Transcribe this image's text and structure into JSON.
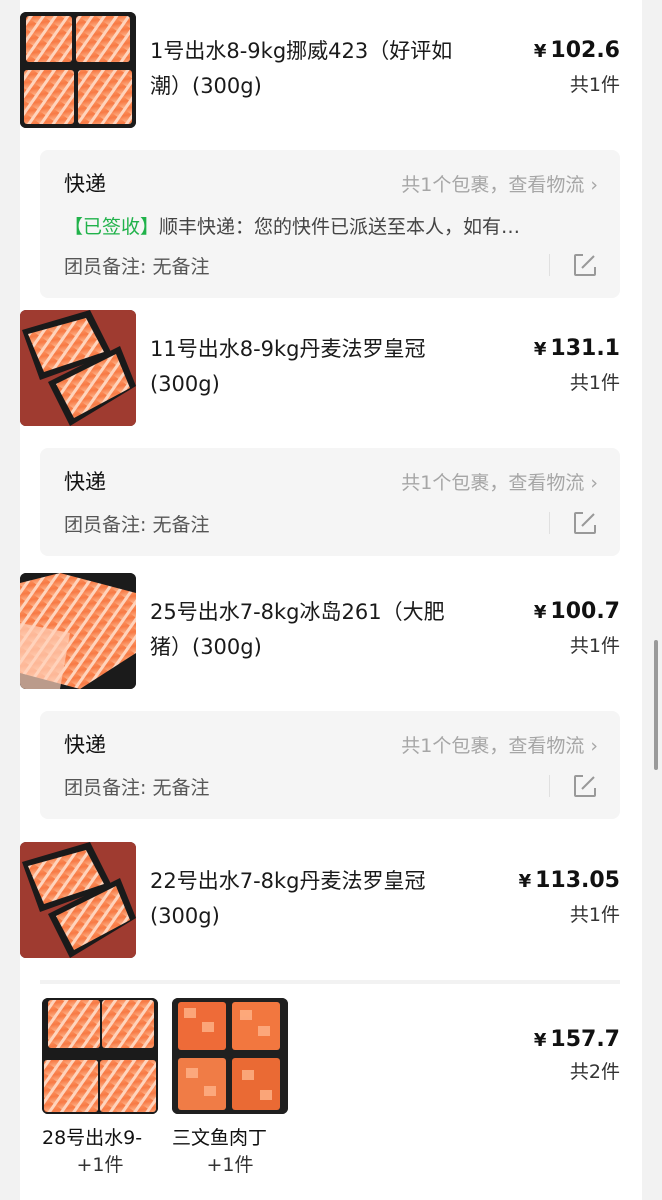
{
  "orders": [
    {
      "name": "1号出水8-9kg挪威423（好评如潮）(300g)",
      "currency": "¥",
      "price": "102.6",
      "count": "共1件"
    },
    {
      "name": "11号出水8-9kg丹麦法罗皇冠(300g)",
      "currency": "¥",
      "price": "131.1",
      "count": "共1件"
    },
    {
      "name": "25号出水7-8kg冰岛261（大肥猪）(300g)",
      "currency": "¥",
      "price": "100.7",
      "count": "共1件"
    },
    {
      "name": "22号出水7-8kg丹麦法罗皇冠(300g)",
      "currency": "¥",
      "price": "113.05",
      "count": "共1件"
    }
  ],
  "shipping": [
    {
      "title": "快递",
      "link": "共1个包裹，查看物流",
      "status_tag": "【已签收】",
      "status_text": "顺丰快递：您的快件已派送至本人，如有…",
      "remark": "团员备注: 无备注"
    },
    {
      "title": "快递",
      "link": "共1个包裹，查看物流",
      "remark": "团员备注: 无备注"
    },
    {
      "title": "快递",
      "link": "共1个包裹，查看物流",
      "remark": "团员备注: 无备注"
    }
  ],
  "multi_order": {
    "currency": "¥",
    "price": "157.7",
    "count": "共2件",
    "items": [
      {
        "name": "28号出水9-",
        "plus": "+1件"
      },
      {
        "name": "三文鱼肉丁",
        "plus": "+1件"
      }
    ]
  },
  "icons": {
    "chevron": "chevron-right-icon",
    "edit": "edit-icon"
  },
  "colors": {
    "signed_tag": "#20b24a",
    "link_gray": "#a6a6a6",
    "panel_bg": "#f5f5f5"
  }
}
